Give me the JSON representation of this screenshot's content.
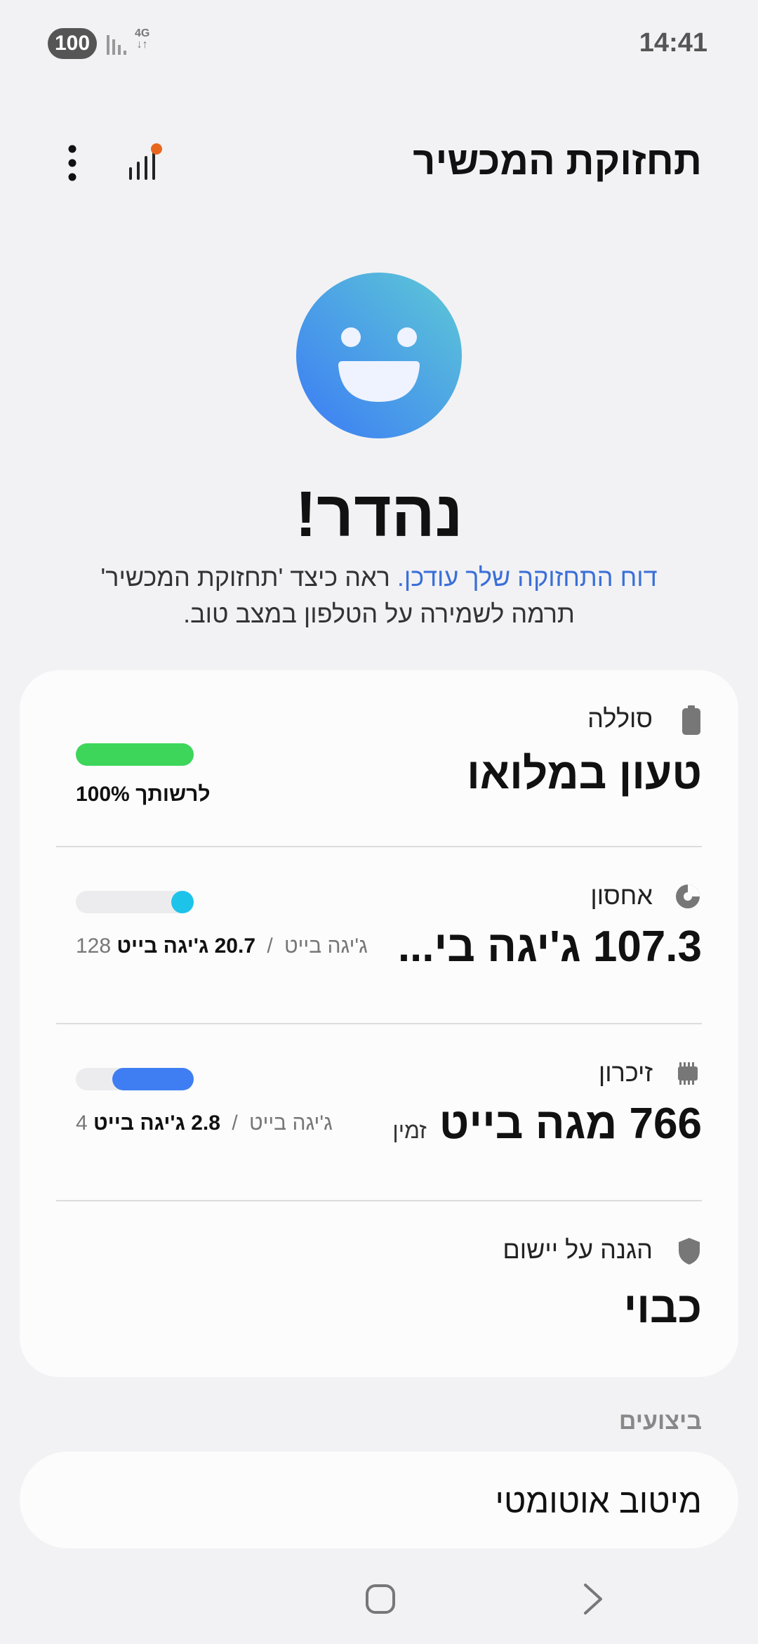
{
  "status_bar": {
    "time": "14:41",
    "battery": "100",
    "network_top": "4G",
    "network_bottom": "↓↑"
  },
  "header": {
    "title": "תחזוקת המכשיר",
    "badge_color": "#e8671d"
  },
  "summary": {
    "headline": "נהדר!",
    "link_text": "דוח התחזוקה שלך עודכן.",
    "description": " ראה כיצד 'תחזוקת המכשיר' תרמה לשמירה על הטלפון במצב טוב."
  },
  "battery": {
    "label": "סוללה",
    "value": "טעון במלואו",
    "caption_value": "100%",
    "caption_text": "לרשותך",
    "level_fraction": 1.0,
    "color": "#3dd65b"
  },
  "storage": {
    "label": "אחסון",
    "value": "107.3 ג'יגה בי...",
    "used": "20.7 ג'יגה בייט",
    "separator": "/",
    "total": "128 ג'יגה בייט",
    "color": "#1ec3ea"
  },
  "memory": {
    "label": "זיכרון",
    "value": "766 מגה בייט",
    "value_suffix": "זמין",
    "used": "2.8 ג'יגה בייט",
    "separator": "/",
    "total": "4 ג'יגה בייט",
    "color": "#3f7ef2"
  },
  "app_protection": {
    "label": "הגנה על יישום",
    "value": "כבוי"
  },
  "performance": {
    "section_title": "ביצועים",
    "auto_optimization": "מיטוב אוטומטי"
  }
}
